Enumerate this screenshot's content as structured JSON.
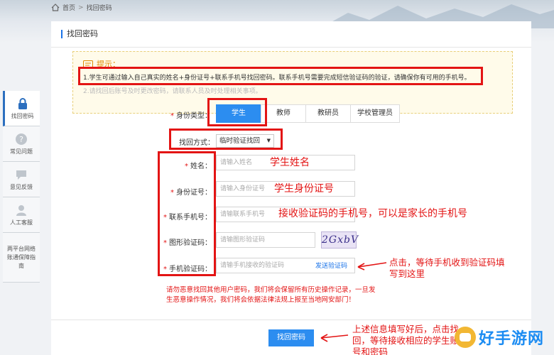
{
  "breadcrumb": {
    "home": "首页",
    "sep": ">",
    "current": "找回密码"
  },
  "sidebar": [
    {
      "label": "找回密码",
      "icon": "lock-icon"
    },
    {
      "label": "常见问题",
      "icon": "question-icon"
    },
    {
      "label": "意见反馈",
      "icon": "chat-icon"
    },
    {
      "label": "人工客服",
      "icon": "user-icon"
    },
    {
      "label": "两平台网络账通保障指南",
      "icon": "none"
    }
  ],
  "panel": {
    "title": "找回密码"
  },
  "tips": {
    "title": "提示：",
    "line1": "1.学生可通过输入自己真实的姓名+身份证号+联系手机号找回密码。联系手机号需要完成短信验证码的验证，请确保你有可用的手机号。",
    "line2": "2.请找回后账号及时更改密码，请联系人员及时处理相关事项。"
  },
  "form": {
    "identity_label": "身份类型",
    "identity_options": [
      "学生",
      "教师",
      "教研员",
      "学校管理员"
    ],
    "identity_selected": "学生",
    "method_label": "找回方式",
    "method_value": "临时验证找回",
    "name_label": "姓名",
    "name_placeholder": "请输入姓名",
    "id_label": "身份证号",
    "id_placeholder": "请输入身份证号",
    "phone_label": "联系手机号",
    "phone_placeholder": "请输联系手机号",
    "captcha_label": "图形验证码",
    "captcha_placeholder": "请输图形验证码",
    "captcha_text": "2GxbV",
    "sms_label": "手机验证码",
    "sms_placeholder": "请输手机接收的验证码",
    "sms_button": "发送验证码",
    "warning": "请勿恶意找回其他用户密码，我们将会保留所有历史操作记录，一旦发生恶意操作情况，我们将会依据法律法规上报至当地网安部门！",
    "submit": "找回密码"
  },
  "annotations": {
    "name": "学生姓名",
    "id": "学生身份证号",
    "phone": "接收验证码的手机号，可以是家长的手机号",
    "sms": "点击，等待手机收到验证码填写到这里",
    "submit": "上述信息填写好后，点击找回，等待接收相应的学生账号和密码"
  },
  "watermark": {
    "text": "好手游网"
  },
  "colors": {
    "accent": "#2c8df0",
    "annotation": "#e31414",
    "tips_bg": "#fffbea"
  }
}
